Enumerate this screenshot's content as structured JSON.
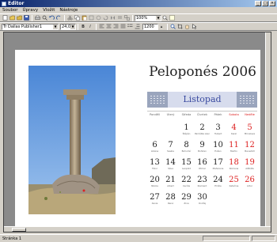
{
  "window": {
    "title": "Editor",
    "controls": [
      "_",
      "□",
      "×"
    ]
  },
  "menu": [
    "Soubor",
    "Úpravy",
    "Vložit",
    "Nástroje"
  ],
  "toolbar": {
    "zoom_value": "100%"
  },
  "format": {
    "font": "Tr Dallas Publisher1",
    "size": "24,0",
    "bold": "B",
    "italic": "I",
    "width": "1200"
  },
  "calendar": {
    "title": "Peloponés 2006",
    "month": "Listopad",
    "weekdays": [
      "Pondělí",
      "Úterý",
      "Středa",
      "Čtvrtek",
      "Pátek",
      "Sobota",
      "Neděle"
    ],
    "weekend_color": "#d22222",
    "days": [
      {
        "d": "1",
        "n": "Štěpán"
      },
      {
        "d": "2",
        "n": "Památka zesnulých"
      },
      {
        "d": "3",
        "n": "Hubert"
      },
      {
        "d": "4",
        "n": "Karel"
      },
      {
        "d": "5",
        "n": "Miroslava"
      },
      {
        "d": "6",
        "n": "Liběna"
      },
      {
        "d": "7",
        "n": "Saskie"
      },
      {
        "d": "8",
        "n": "Bohumír"
      },
      {
        "d": "9",
        "n": "Bohdan"
      },
      {
        "d": "10",
        "n": "Evžen"
      },
      {
        "d": "11",
        "n": "Martin"
      },
      {
        "d": "12",
        "n": "Benedikt"
      },
      {
        "d": "13",
        "n": "Tibor"
      },
      {
        "d": "14",
        "n": "Sáva"
      },
      {
        "d": "15",
        "n": "Leopold"
      },
      {
        "d": "16",
        "n": "Otmar"
      },
      {
        "d": "17",
        "n": "Mahulena"
      },
      {
        "d": "18",
        "n": "Romana"
      },
      {
        "d": "19",
        "n": "Alžběta"
      },
      {
        "d": "20",
        "n": "Nikola"
      },
      {
        "d": "21",
        "n": "Albert"
      },
      {
        "d": "22",
        "n": "Cecílie"
      },
      {
        "d": "23",
        "n": "Klement"
      },
      {
        "d": "24",
        "n": "Emílie"
      },
      {
        "d": "25",
        "n": "Kateřina"
      },
      {
        "d": "26",
        "n": "Artur"
      },
      {
        "d": "27",
        "n": "Xenie"
      },
      {
        "d": "28",
        "n": "René"
      },
      {
        "d": "29",
        "n": "Zina"
      },
      {
        "d": "30",
        "n": "Ondřej"
      }
    ]
  },
  "status": {
    "text": "Stránka 1"
  }
}
